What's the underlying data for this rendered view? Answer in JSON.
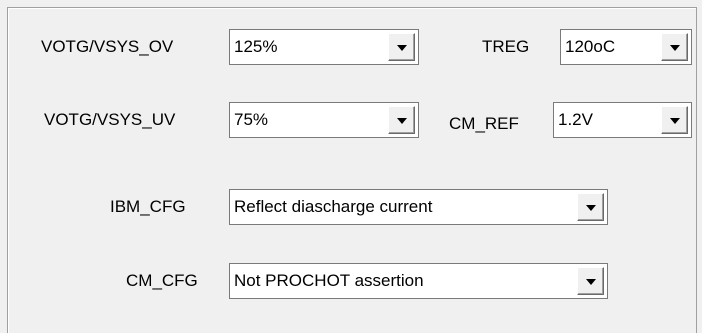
{
  "fields": {
    "votg_vsys_ov": {
      "label": "VOTG/VSYS_OV",
      "value": "125%"
    },
    "treg": {
      "label": "TREG",
      "value": "120oC"
    },
    "votg_vsys_uv": {
      "label": "VOTG/VSYS_UV",
      "value": "75%"
    },
    "cm_ref": {
      "label": "CM_REF",
      "value": "1.2V"
    },
    "ibm_cfg": {
      "label": "IBM_CFG",
      "value": "Reflect diascharge current"
    },
    "cm_cfg": {
      "label": "CM_CFG",
      "value": "Not PROCHOT assertion"
    }
  },
  "icons": {
    "dropdown": "chevron-down-icon"
  }
}
